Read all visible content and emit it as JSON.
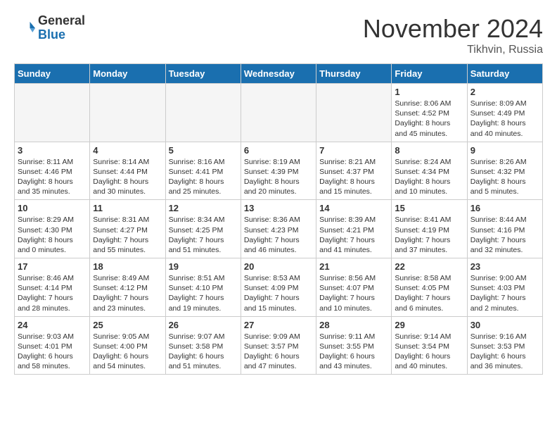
{
  "header": {
    "logo_line1": "General",
    "logo_line2": "Blue",
    "month": "November 2024",
    "location": "Tikhvin, Russia"
  },
  "weekdays": [
    "Sunday",
    "Monday",
    "Tuesday",
    "Wednesday",
    "Thursday",
    "Friday",
    "Saturday"
  ],
  "weeks": [
    [
      {
        "day": "",
        "info": ""
      },
      {
        "day": "",
        "info": ""
      },
      {
        "day": "",
        "info": ""
      },
      {
        "day": "",
        "info": ""
      },
      {
        "day": "",
        "info": ""
      },
      {
        "day": "1",
        "info": "Sunrise: 8:06 AM\nSunset: 4:52 PM\nDaylight: 8 hours and 45 minutes."
      },
      {
        "day": "2",
        "info": "Sunrise: 8:09 AM\nSunset: 4:49 PM\nDaylight: 8 hours and 40 minutes."
      }
    ],
    [
      {
        "day": "3",
        "info": "Sunrise: 8:11 AM\nSunset: 4:46 PM\nDaylight: 8 hours and 35 minutes."
      },
      {
        "day": "4",
        "info": "Sunrise: 8:14 AM\nSunset: 4:44 PM\nDaylight: 8 hours and 30 minutes."
      },
      {
        "day": "5",
        "info": "Sunrise: 8:16 AM\nSunset: 4:41 PM\nDaylight: 8 hours and 25 minutes."
      },
      {
        "day": "6",
        "info": "Sunrise: 8:19 AM\nSunset: 4:39 PM\nDaylight: 8 hours and 20 minutes."
      },
      {
        "day": "7",
        "info": "Sunrise: 8:21 AM\nSunset: 4:37 PM\nDaylight: 8 hours and 15 minutes."
      },
      {
        "day": "8",
        "info": "Sunrise: 8:24 AM\nSunset: 4:34 PM\nDaylight: 8 hours and 10 minutes."
      },
      {
        "day": "9",
        "info": "Sunrise: 8:26 AM\nSunset: 4:32 PM\nDaylight: 8 hours and 5 minutes."
      }
    ],
    [
      {
        "day": "10",
        "info": "Sunrise: 8:29 AM\nSunset: 4:30 PM\nDaylight: 8 hours and 0 minutes."
      },
      {
        "day": "11",
        "info": "Sunrise: 8:31 AM\nSunset: 4:27 PM\nDaylight: 7 hours and 55 minutes."
      },
      {
        "day": "12",
        "info": "Sunrise: 8:34 AM\nSunset: 4:25 PM\nDaylight: 7 hours and 51 minutes."
      },
      {
        "day": "13",
        "info": "Sunrise: 8:36 AM\nSunset: 4:23 PM\nDaylight: 7 hours and 46 minutes."
      },
      {
        "day": "14",
        "info": "Sunrise: 8:39 AM\nSunset: 4:21 PM\nDaylight: 7 hours and 41 minutes."
      },
      {
        "day": "15",
        "info": "Sunrise: 8:41 AM\nSunset: 4:19 PM\nDaylight: 7 hours and 37 minutes."
      },
      {
        "day": "16",
        "info": "Sunrise: 8:44 AM\nSunset: 4:16 PM\nDaylight: 7 hours and 32 minutes."
      }
    ],
    [
      {
        "day": "17",
        "info": "Sunrise: 8:46 AM\nSunset: 4:14 PM\nDaylight: 7 hours and 28 minutes."
      },
      {
        "day": "18",
        "info": "Sunrise: 8:49 AM\nSunset: 4:12 PM\nDaylight: 7 hours and 23 minutes."
      },
      {
        "day": "19",
        "info": "Sunrise: 8:51 AM\nSunset: 4:10 PM\nDaylight: 7 hours and 19 minutes."
      },
      {
        "day": "20",
        "info": "Sunrise: 8:53 AM\nSunset: 4:09 PM\nDaylight: 7 hours and 15 minutes."
      },
      {
        "day": "21",
        "info": "Sunrise: 8:56 AM\nSunset: 4:07 PM\nDaylight: 7 hours and 10 minutes."
      },
      {
        "day": "22",
        "info": "Sunrise: 8:58 AM\nSunset: 4:05 PM\nDaylight: 7 hours and 6 minutes."
      },
      {
        "day": "23",
        "info": "Sunrise: 9:00 AM\nSunset: 4:03 PM\nDaylight: 7 hours and 2 minutes."
      }
    ],
    [
      {
        "day": "24",
        "info": "Sunrise: 9:03 AM\nSunset: 4:01 PM\nDaylight: 6 hours and 58 minutes."
      },
      {
        "day": "25",
        "info": "Sunrise: 9:05 AM\nSunset: 4:00 PM\nDaylight: 6 hours and 54 minutes."
      },
      {
        "day": "26",
        "info": "Sunrise: 9:07 AM\nSunset: 3:58 PM\nDaylight: 6 hours and 51 minutes."
      },
      {
        "day": "27",
        "info": "Sunrise: 9:09 AM\nSunset: 3:57 PM\nDaylight: 6 hours and 47 minutes."
      },
      {
        "day": "28",
        "info": "Sunrise: 9:11 AM\nSunset: 3:55 PM\nDaylight: 6 hours and 43 minutes."
      },
      {
        "day": "29",
        "info": "Sunrise: 9:14 AM\nSunset: 3:54 PM\nDaylight: 6 hours and 40 minutes."
      },
      {
        "day": "30",
        "info": "Sunrise: 9:16 AM\nSunset: 3:53 PM\nDaylight: 6 hours and 36 minutes."
      }
    ]
  ]
}
